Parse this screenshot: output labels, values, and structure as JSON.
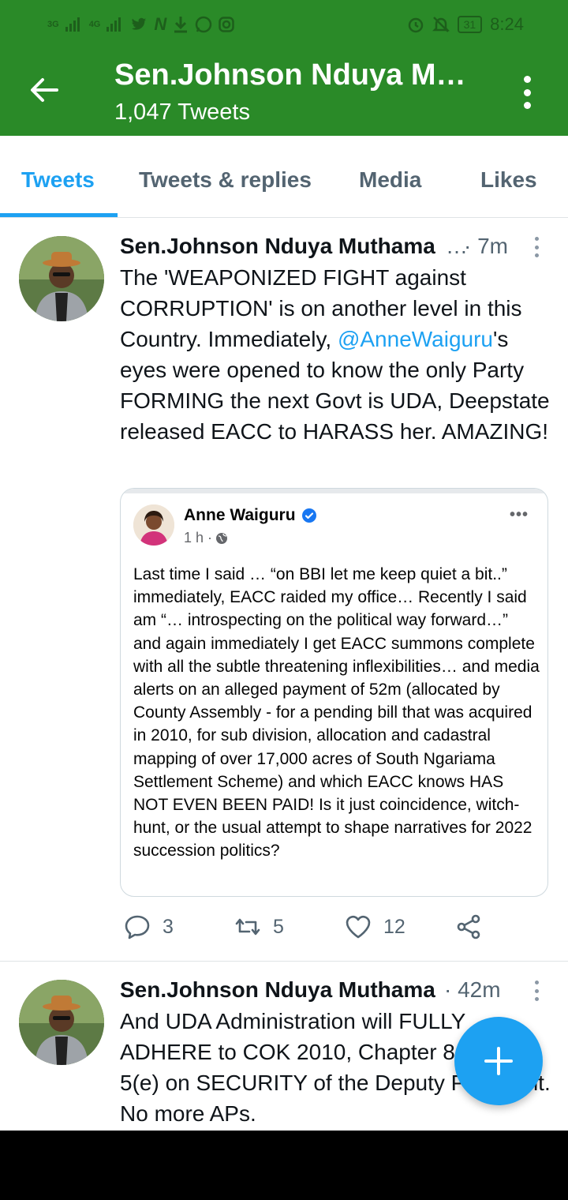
{
  "status_bar": {
    "network_1": "3G",
    "network_2": "4G",
    "time": "8:24",
    "battery": "31",
    "icons": [
      "signal-icon",
      "twitter-icon",
      "n-icon",
      "download-icon",
      "whatsapp-icon",
      "instagram-icon",
      "alarm-icon",
      "mute-icon",
      "battery-icon"
    ]
  },
  "header": {
    "title": "Sen.Johnson Nduya M…",
    "subtitle": "1,047 Tweets",
    "back_icon": "back-arrow-icon",
    "more_icon": "more-vertical-icon"
  },
  "tabs": [
    {
      "label": "Tweets",
      "active": true
    },
    {
      "label": "Tweets & replies",
      "active": false
    },
    {
      "label": "Media",
      "active": false
    },
    {
      "label": "Likes",
      "active": false
    }
  ],
  "tweets": [
    {
      "author": "Sen.Johnson Nduya Muthama",
      "author_ellipsis": "…",
      "time": "· 7m",
      "text_1": "The 'WEAPONIZED FIGHT against CORRUPTION' is on another level in this Country. Immediately, ",
      "mention": "@AnneWaiguru",
      "text_2": "'s eyes were opened to know the only Party FORMING the next Govt is UDA, Deepstate released  EACC to HARASS her. AMAZING!",
      "quote": {
        "name": "Anne Waiguru",
        "time": "1 h ·",
        "text": "Last time I said … “on BBI let me keep quiet a bit..” immediately, EACC raided my office…  Recently I said am “… introspecting on the political way forward…”  and again immediately I get EACC summons complete with all the subtle threatening inflexibilities… and media alerts on an alleged payment of 52m (allocated by County Assembly - for a pending bill that was acquired in 2010, for sub division, allocation and cadastral mapping of over 17,000 acres of South Ngariama Settlement Scheme) and which EACC knows HAS NOT EVEN BEEN PAID!  Is it just coincidence, witch-hunt, or the usual attempt to shape narratives for 2022 succession politics?"
      },
      "replies": "3",
      "retweets": "5",
      "likes": "12"
    },
    {
      "author": "Sen.Johnson Nduya Muthama",
      "time": "· 42m",
      "text": "And UDA Administration will FULLY ADHERE to COK 2010, Chapter 8, Section 5(e) on SECURITY of the Deputy President. No more APs."
    }
  ],
  "colors": {
    "header_green": "#2a8a28",
    "accent_blue": "#1da1f2",
    "muted": "#536471"
  }
}
